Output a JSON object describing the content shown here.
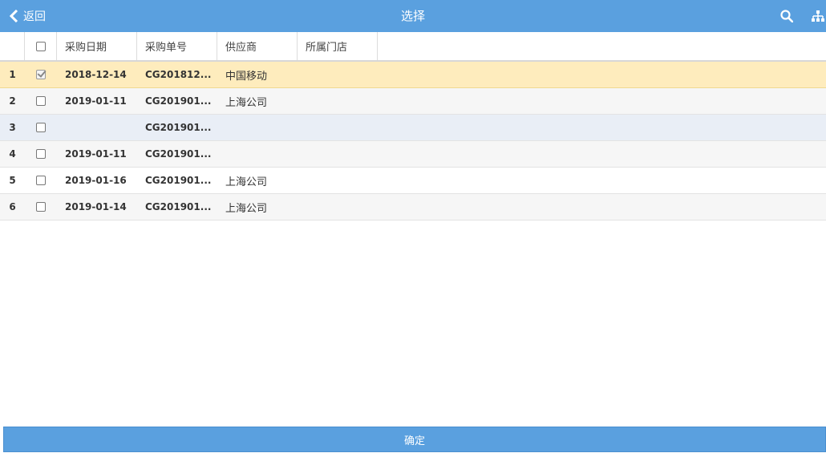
{
  "header": {
    "back_label": "返回",
    "title": "选择",
    "icons": [
      "search-icon",
      "org-chart-icon"
    ]
  },
  "table": {
    "columns": [
      "采购日期",
      "采购单号",
      "供应商",
      "所属门店"
    ],
    "rows": [
      {
        "num": "1",
        "checked": true,
        "date": "2018-12-14",
        "order_no": "CG201812...",
        "supplier": "中国移动",
        "store": ""
      },
      {
        "num": "2",
        "checked": false,
        "date": "2019-01-11",
        "order_no": "CG201901...",
        "supplier": "上海公司",
        "store": ""
      },
      {
        "num": "3",
        "checked": false,
        "date": "",
        "order_no": "CG201901...",
        "supplier": "",
        "store": ""
      },
      {
        "num": "4",
        "checked": false,
        "date": "2019-01-11",
        "order_no": "CG201901...",
        "supplier": "",
        "store": ""
      },
      {
        "num": "5",
        "checked": false,
        "date": "2019-01-16",
        "order_no": "CG201901...",
        "supplier": "上海公司",
        "store": ""
      },
      {
        "num": "6",
        "checked": false,
        "date": "2019-01-14",
        "order_no": "CG201901...",
        "supplier": "上海公司",
        "store": ""
      }
    ]
  },
  "footer": {
    "confirm_label": "确定"
  },
  "colors": {
    "accent": "#5aa0df",
    "selected_row": "#feecbd"
  }
}
